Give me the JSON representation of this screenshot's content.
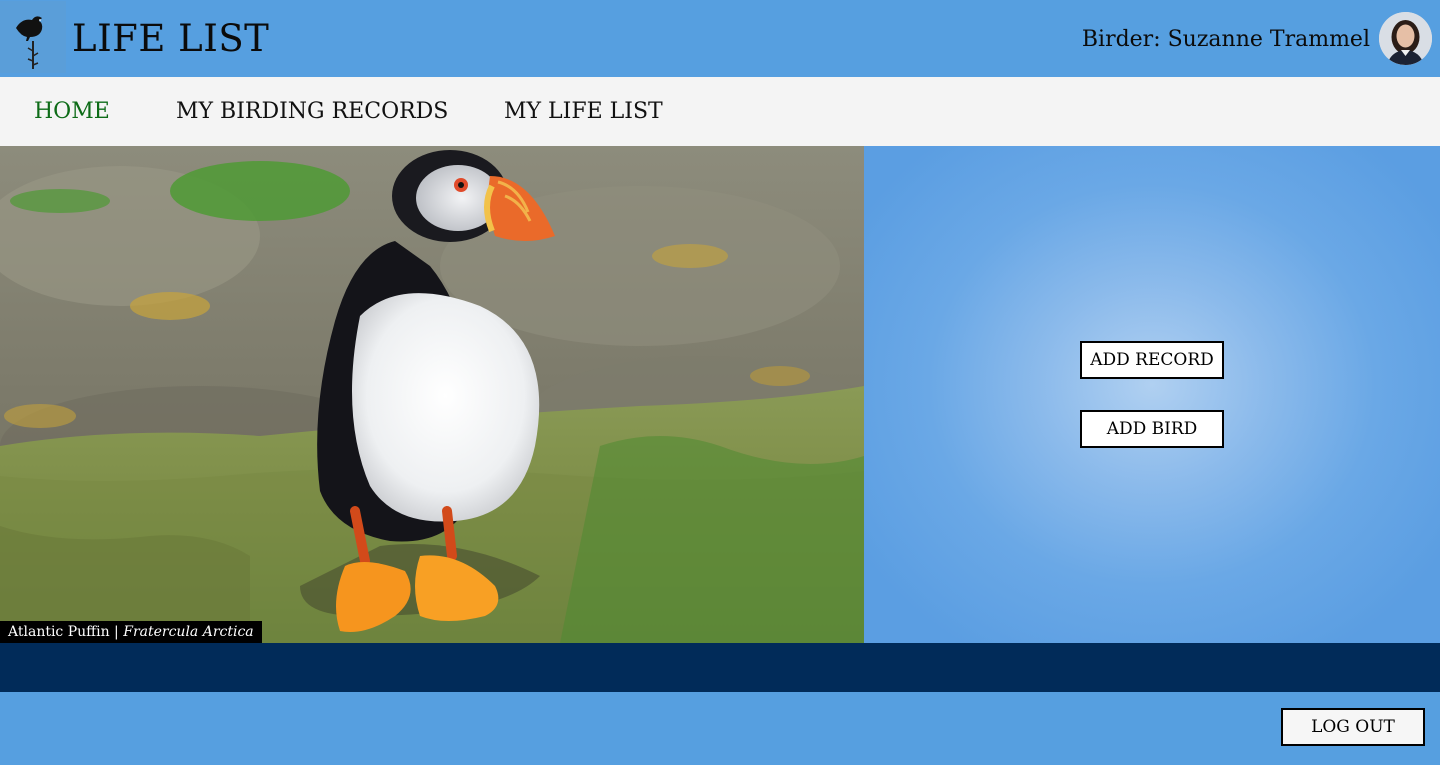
{
  "header": {
    "title": "LIFE LIST",
    "birder_label": "Birder: Suzanne Trammel"
  },
  "nav": {
    "items": [
      {
        "label": "HOME",
        "active": true
      },
      {
        "label": "MY BIRDING RECORDS",
        "active": false
      },
      {
        "label": "MY LIFE LIST",
        "active": false
      }
    ]
  },
  "hero": {
    "caption_common": "Atlantic Puffin",
    "caption_separator": " | ",
    "caption_scientific": "Fratercula Arctica"
  },
  "actions": {
    "add_record": "ADD RECORD",
    "add_bird": "ADD BIRD"
  },
  "footer": {
    "logout": "LOG OUT"
  },
  "icons": {
    "logo": "bird-on-branch-icon",
    "avatar": "user-avatar"
  },
  "colors": {
    "header_bg": "#569fe0",
    "nav_active": "#0d6b17",
    "band": "#012b59"
  }
}
